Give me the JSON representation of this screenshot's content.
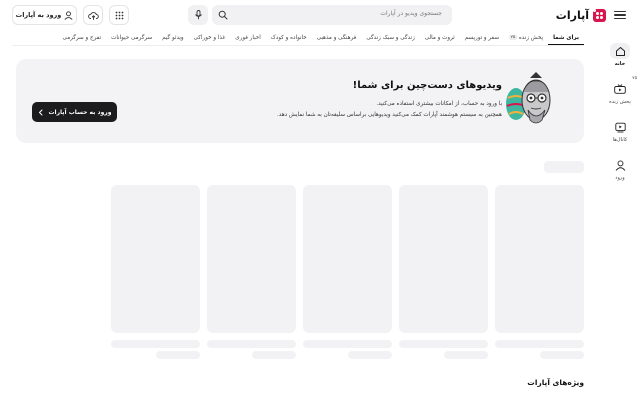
{
  "header": {
    "logo_text": "آپارات",
    "search_placeholder": "جستجوی ویدیو در آپارات",
    "login_label": "ورود به آپارات"
  },
  "tabs": [
    {
      "label": "برای شما",
      "active": true
    },
    {
      "label": "پخش زنده",
      "badge": "۷۵"
    },
    {
      "label": "سفر و توریسم"
    },
    {
      "label": "ثروت و مالی"
    },
    {
      "label": "زندگی و سبک زندگی"
    },
    {
      "label": "فرهنگی و مذهبی"
    },
    {
      "label": "خانواده و کودک"
    },
    {
      "label": "اخبار فوری"
    },
    {
      "label": "غذا و خوراکی"
    },
    {
      "label": "ویدئو گیم"
    },
    {
      "label": "سرگرمی حیوانات"
    },
    {
      "label": "تفرج و سرگرمی"
    }
  ],
  "sidebar": {
    "items": [
      {
        "label": "خانه",
        "icon": "home-icon",
        "active": true
      },
      {
        "label": "پخش زنده",
        "icon": "live-tv-icon",
        "badge": "۷۵"
      },
      {
        "label": "کانال‌ها",
        "icon": "play-square-icon"
      },
      {
        "label": "ورود",
        "icon": "user-icon"
      }
    ]
  },
  "banner": {
    "title": "ویدیوهای دست‌چین برای شما!",
    "line1": "با ورود به حساب، از امکانات بیشتری استفاده می‌کنید.",
    "line2": "همچنین به سیستم هوشمند آپارات کمک می‌کنید ویدیوهایی براساس سلیقه‌تان به شما نمایش دهد.",
    "cta_label": "ورود به حساب آپارات"
  },
  "section": {
    "title": "ویژه‌های آپارات"
  },
  "colors": {
    "brand": "#d7164f",
    "skeleton": "#f2f2f4",
    "banner_bg": "#f3f3f5",
    "cta_bg": "#1c1c1e"
  }
}
